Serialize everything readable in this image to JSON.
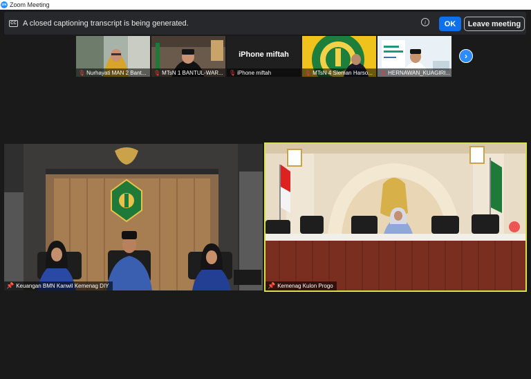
{
  "window": {
    "title": "Zoom Meeting",
    "logo": "zm"
  },
  "captions_bar": {
    "cc_icon": "CC",
    "message": "A closed captioning transcript is being generated.",
    "info_icon": "i",
    "ok_label": "OK",
    "leave_label": "Leave meeting"
  },
  "thumbnails": [
    {
      "name": "Nurhayati MAN 2 Bant...",
      "muted": true
    },
    {
      "name": "MTsN 1 BANTUL-WAR...",
      "muted": true
    },
    {
      "name": "iPhone miftah",
      "display_text": "iPhone miftah",
      "muted": true
    },
    {
      "name": "MTsN 4 Sleman Harso...",
      "muted": true
    },
    {
      "name": "HERNAWAN_KUAGIRI...",
      "muted": true
    }
  ],
  "thumbnail_nav": {
    "icon": "chevron-right-icon",
    "glyph": "›"
  },
  "main_videos": [
    {
      "name": "Keuangan BMN Kanwil Kemenag DIY",
      "pinned": true
    },
    {
      "name": "Kemenag Kulon Progo",
      "pinned": true,
      "active_speaker": true
    }
  ],
  "colors": {
    "active_speaker_border": "#d8e34a",
    "ok_button": "#0e71eb",
    "muted_mic": "#e23c3c",
    "nav_button": "#2d8cff"
  },
  "icons": {
    "mic_muted": "🎙",
    "pin": "📌"
  }
}
